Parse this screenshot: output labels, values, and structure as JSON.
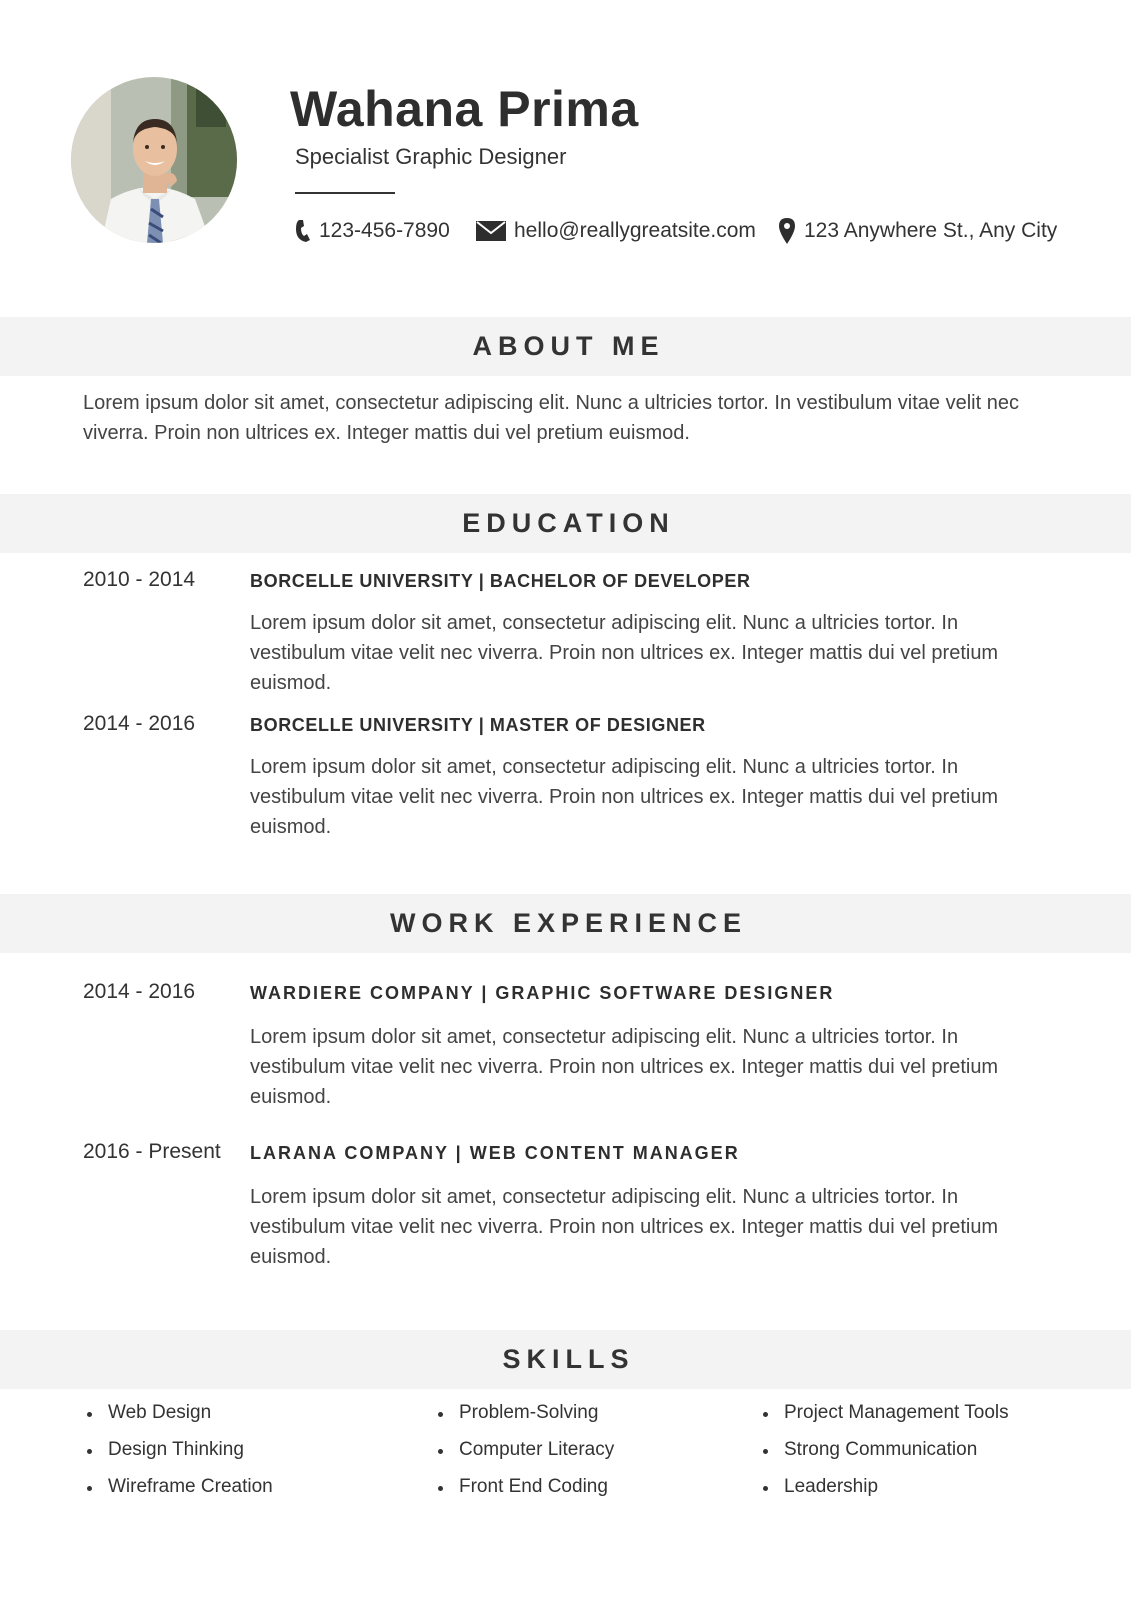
{
  "header": {
    "name": "Wahana Prima",
    "role": "Specialist Graphic Designer",
    "phone": "123-456-7890",
    "email": "hello@reallygreatsite.com",
    "address": "123 Anywhere St., Any City"
  },
  "about": {
    "heading": "ABOUT ME",
    "text": "Lorem ipsum dolor sit amet, consectetur adipiscing elit. Nunc a ultricies tortor. In vestibulum vitae velit nec viverra. Proin non ultrices ex. Integer mattis dui vel pretium euismod."
  },
  "education": {
    "heading": "EDUCATION",
    "items": [
      {
        "period": "2010 - 2014",
        "title": "BORCELLE UNIVERSITY | BACHELOR OF DEVELOPER",
        "description": "Lorem ipsum dolor sit amet, consectetur adipiscing elit. Nunc a ultricies tortor. In vestibulum vitae velit nec viverra. Proin non ultrices ex. Integer mattis dui vel pretium euismod."
      },
      {
        "period": "2014 - 2016",
        "title": "BORCELLE  UNIVERSITY | MASTER OF DESIGNER",
        "description": "Lorem ipsum dolor sit amet, consectetur adipiscing elit. Nunc a ultricies tortor. In vestibulum vitae velit nec viverra. Proin non ultrices ex. Integer mattis dui vel pretium euismod."
      }
    ]
  },
  "work": {
    "heading": "WORK EXPERIENCE",
    "items": [
      {
        "period": "2014 - 2016",
        "title": "WARDIERE COMPANY | GRAPHIC SOFTWARE DESIGNER",
        "description": "Lorem ipsum dolor sit amet, consectetur adipiscing elit. Nunc a ultricies tortor. In vestibulum vitae velit nec viverra. Proin non ultrices ex. Integer mattis dui vel pretium euismod."
      },
      {
        "period": "2016 - Present",
        "title": "LARANA COMPANY | WEB CONTENT MANAGER",
        "description": "Lorem ipsum dolor sit amet, consectetur adipiscing elit. Nunc a ultricies tortor. In vestibulum vitae velit nec viverra. Proin non ultrices ex. Integer mattis dui vel pretium euismod."
      }
    ]
  },
  "skills": {
    "heading": "SKILLS",
    "columns": [
      [
        "Web Design",
        "Design Thinking",
        "Wireframe Creation"
      ],
      [
        "Problem-Solving",
        "Computer Literacy",
        "Front End Coding"
      ],
      [
        "Project Management Tools",
        "Strong Communication",
        "Leadership"
      ]
    ]
  },
  "icons": [
    "profile-photo",
    "phone-icon",
    "mail-icon",
    "location-pin-icon"
  ]
}
